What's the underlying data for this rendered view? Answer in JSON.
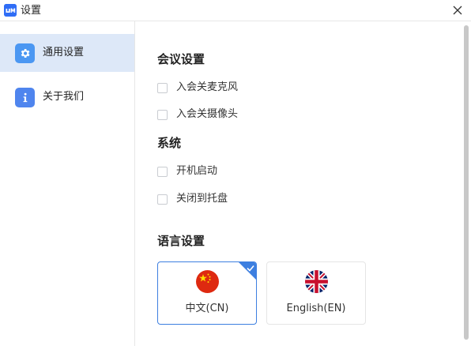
{
  "window": {
    "title": "设置",
    "logo_icon": "app-logo-icon",
    "accent_color": "#2f6df6"
  },
  "sidebar": {
    "items": [
      {
        "label": "通用设置",
        "icon": "gear-icon",
        "active": true
      },
      {
        "label": "关于我们",
        "icon": "info-icon",
        "active": false
      }
    ]
  },
  "main": {
    "meeting": {
      "title": "会议设置",
      "options": [
        {
          "label": "入会关麦克风",
          "checked": false
        },
        {
          "label": "入会关摄像头",
          "checked": false
        }
      ]
    },
    "system": {
      "title": "系统",
      "options": [
        {
          "label": "开机启动",
          "checked": false
        },
        {
          "label": "关闭到托盘",
          "checked": false
        }
      ]
    },
    "language": {
      "title": "语言设置",
      "options": [
        {
          "label": "中文(CN)",
          "icon": "china-flag-icon",
          "selected": true
        },
        {
          "label": "English(EN)",
          "icon": "uk-flag-icon",
          "selected": false
        }
      ]
    }
  },
  "colors": {
    "active_nav_bg": "#dde8f8",
    "selected_border": "#3d7fe0"
  }
}
